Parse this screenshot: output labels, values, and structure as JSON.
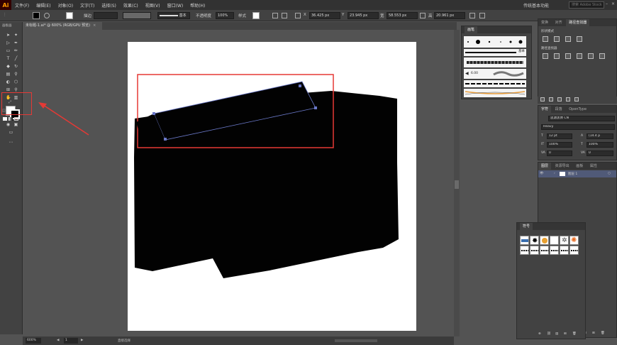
{
  "menubar": {
    "app_logo": "Ai",
    "items": [
      "文件(F)",
      "编辑(E)",
      "对象(O)",
      "文字(T)",
      "选择(S)",
      "效果(C)",
      "视图(V)",
      "窗口(W)",
      "帮助(H)"
    ],
    "workspace": "传统基本功能",
    "search_placeholder": "搜索 Adobe Stock"
  },
  "controlbar": {
    "stroke_label": "描边",
    "stroke_style": "基本",
    "opacity_label": "不透明度",
    "opacity_value": "100%",
    "style_label": "样式",
    "x_label": "X",
    "x_value": "36.425 px",
    "y_label": "Y",
    "y_value": "23.945 px",
    "w_label": "宽",
    "w_value": "58.553 px",
    "h_label": "高",
    "h_value": "20.961 px"
  },
  "tab": {
    "title": "未标题-1.ai* @ 600% (RGB/GPU 预览)",
    "close": "×"
  },
  "toolpanel": {
    "title": "画板画"
  },
  "statusbar": {
    "zoom": "600%",
    "page": "1",
    "tool_name": "直接选择"
  },
  "brushes_panel": {
    "title": "画笔",
    "basic_label": "基本",
    "size_label": "6.00"
  },
  "pathfinder_panel": {
    "tabs": [
      "变换",
      "对齐",
      "路径查找器"
    ],
    "shape_modes_label": "形状模式",
    "pathfinder_label": "路径查找器"
  },
  "character_panel": {
    "tabs": [
      "字符",
      "段落",
      "OpenType"
    ],
    "font_family": "思源黑体 CN",
    "font_style": "Heavy",
    "font_size": "12 pt",
    "leading": "(14.4 p",
    "scale_h": "100%",
    "scale_v": "100%",
    "kerning": "0",
    "tracking": "0"
  },
  "layers_panel": {
    "tabs": [
      "图层",
      "资源导出",
      "画板",
      "属性"
    ],
    "layer_name": "图层 1"
  },
  "symbols_panel": {
    "title": "符号"
  },
  "colors": {
    "accent_red": "#e53935",
    "path_blue": "#6a78c8"
  }
}
